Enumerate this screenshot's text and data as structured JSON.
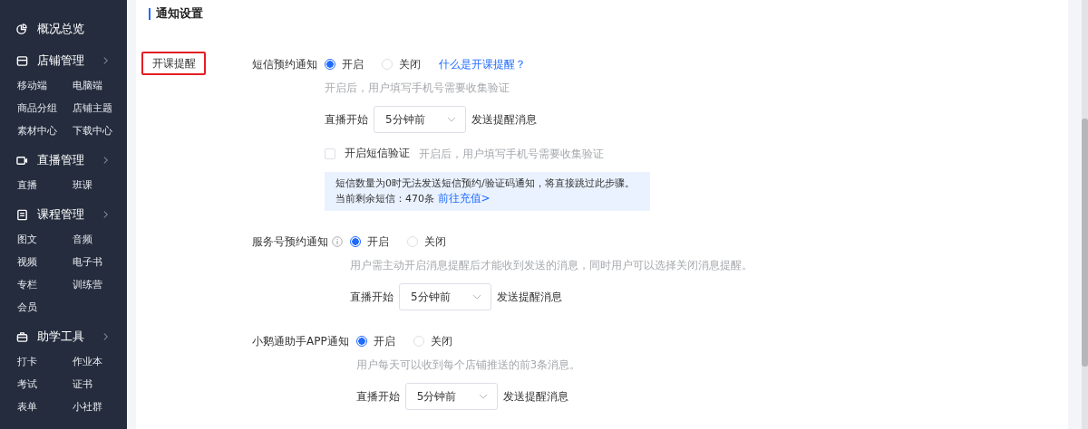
{
  "sidebar": {
    "items": [
      {
        "kind": "link",
        "label": "概况总览"
      },
      {
        "kind": "group",
        "label": "店铺管理",
        "children": [
          {
            "label": "移动端"
          },
          {
            "label": "电脑端"
          },
          {
            "label": "商品分组"
          },
          {
            "label": "店铺主题"
          },
          {
            "label": "素材中心"
          },
          {
            "label": "下载中心"
          }
        ]
      },
      {
        "kind": "group",
        "label": "直播管理",
        "children": [
          {
            "label": "直播"
          },
          {
            "label": "班课"
          }
        ]
      },
      {
        "kind": "group",
        "label": "课程管理",
        "children": [
          {
            "label": "图文"
          },
          {
            "label": "音频"
          },
          {
            "label": "视频"
          },
          {
            "label": "电子书"
          },
          {
            "label": "专栏"
          },
          {
            "label": "训练营"
          },
          {
            "label": "会员"
          }
        ]
      },
      {
        "kind": "group",
        "label": "助学工具",
        "children": [
          {
            "label": "打卡"
          },
          {
            "label": "作业本"
          },
          {
            "label": "考试"
          },
          {
            "label": "证书"
          },
          {
            "label": "表单"
          },
          {
            "label": "小社群"
          }
        ]
      }
    ]
  },
  "section_title": "通知设置",
  "category": "开课提醒",
  "notifications": [
    {
      "label": "短信预约通知",
      "info_icon": false,
      "options": [
        {
          "label": "开启",
          "selected": true
        },
        {
          "label": "关闭",
          "selected": false
        }
      ],
      "link": "什么是开课提醒？",
      "hint": "开启后，用户填写手机号需要收集验证",
      "timing": {
        "prefix": "直播开始",
        "value": "5分钟前",
        "suffix": "发送提醒消息"
      },
      "sms_verify": {
        "label": "开启短信验证",
        "checked": false,
        "hint": "开启后，用户填写手机号需要收集验证"
      },
      "notice": {
        "line_1": "短信数量为0时无法发送短信预约/验证码通知，将直接跳过此步骤。",
        "line_2": "当前剩余短信：470条",
        "link": "前往充值>"
      }
    },
    {
      "label": "服务号预约通知",
      "info_icon": true,
      "options": [
        {
          "label": "开启",
          "selected": true
        },
        {
          "label": "关闭",
          "selected": false
        }
      ],
      "hint": "用户需主动开启消息提醒后才能收到发送的消息，同时用户可以选择关闭消息提醒。",
      "timing": {
        "prefix": "直播开始",
        "value": "5分钟前",
        "suffix": "发送提醒消息"
      }
    },
    {
      "label": "小鹅通助手APP通知",
      "info_icon": false,
      "options": [
        {
          "label": "开启",
          "selected": true
        },
        {
          "label": "关闭",
          "selected": false
        }
      ],
      "hint": "用户每天可以收到每个店铺推送的前3条消息。",
      "timing": {
        "prefix": "直播开始",
        "value": "5分钟前",
        "suffix": "发送提醒消息"
      }
    }
  ]
}
